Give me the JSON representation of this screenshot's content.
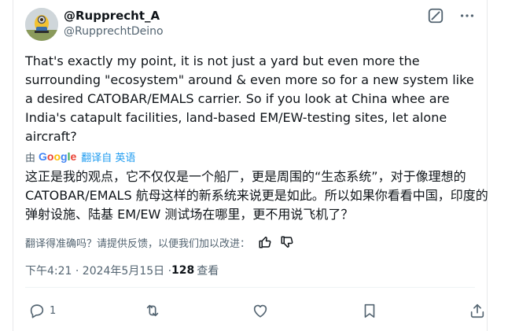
{
  "author": {
    "display_name": "@Rupprecht_A",
    "handle": "@RupprechtDeino"
  },
  "tweet": {
    "text": "That's exactly my point, it is not just a yard but even more the surrounding \"ecosystem\" around & even more so for a new system like a desired CATOBAR/EMALS carrier. So if you look at China whee are India's catapult facilities, land-based EM/EW-testing sites, let alone aircraft?"
  },
  "translation": {
    "prefix": "由",
    "provider_letters": [
      "G",
      "o",
      "o",
      "g",
      "l",
      "e"
    ],
    "provider_colors": [
      "#4285F4",
      "#EA4335",
      "#FBBC05",
      "#4285F4",
      "#34A853",
      "#EA4335"
    ],
    "label": "翻译自 英语",
    "text": "这正是我的观点，它不仅仅是一个船厂，更是周围的“生态系统”，对于像理想的 CATOBAR/EMALS 航母这样的新系统来说更是如此。所以如果你看看中国，印度的弹射设施、陆基 EM/EW 测试场在哪里，更不用说飞机了？",
    "feedback_prompt": "翻译得准确吗？请提供反馈，以便我们加以改进："
  },
  "meta": {
    "timestamp": "下午4:21 · 2024年5月15日 · ",
    "view_count": "128",
    "view_label": "查看"
  },
  "actions": {
    "reply_count": "1"
  },
  "icons": {
    "grok": "grok-icon",
    "more": "more-icon",
    "thumbs_up": "thumbs-up-icon",
    "thumbs_down": "thumbs-down-icon",
    "reply": "reply-icon",
    "retweet": "retweet-icon",
    "like": "like-icon",
    "bookmark": "bookmark-icon",
    "share": "share-icon"
  }
}
